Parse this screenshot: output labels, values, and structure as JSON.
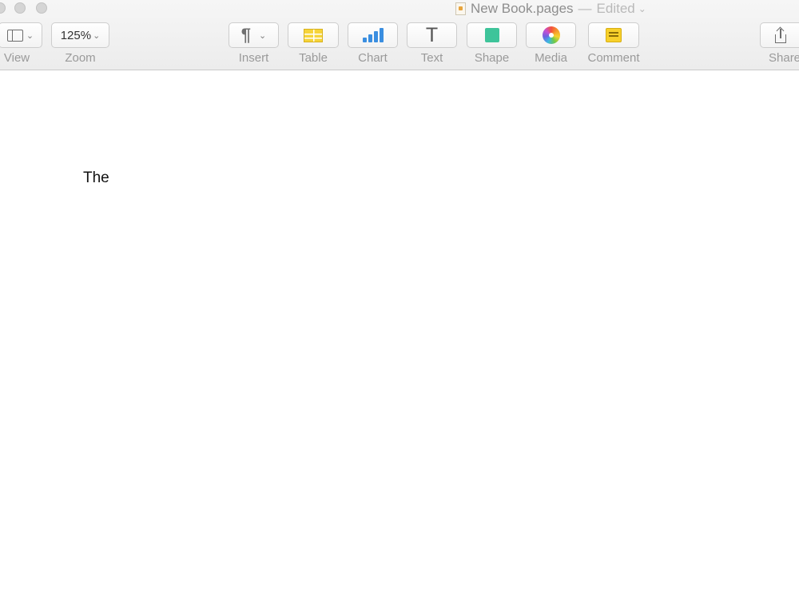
{
  "window": {
    "title": "New Book.pages",
    "title_separator": "—",
    "status": "Edited",
    "status_chevron": "⌄"
  },
  "toolbar": {
    "view": {
      "label": "View",
      "icon": "sidebar-icon",
      "chevron": "⌄"
    },
    "zoom": {
      "label": "Zoom",
      "value": "125%",
      "chevron": "⌄"
    },
    "insert": {
      "label": "Insert",
      "icon": "pilcrow-icon",
      "glyph": "¶",
      "chevron": "⌄"
    },
    "table": {
      "label": "Table",
      "icon": "table-icon",
      "color": "#f6d43a"
    },
    "chart": {
      "label": "Chart",
      "icon": "bar-chart-icon",
      "color": "#3a8ee0"
    },
    "text": {
      "label": "Text",
      "icon": "text-icon",
      "glyph": "T"
    },
    "shape": {
      "label": "Shape",
      "icon": "shape-icon",
      "color": "#3ec49a"
    },
    "media": {
      "label": "Media",
      "icon": "photos-icon"
    },
    "comment": {
      "label": "Comment",
      "icon": "comment-icon",
      "color": "#f7d02b"
    },
    "share": {
      "label": "Share",
      "icon": "share-icon"
    }
  },
  "document": {
    "body_text": "The"
  }
}
